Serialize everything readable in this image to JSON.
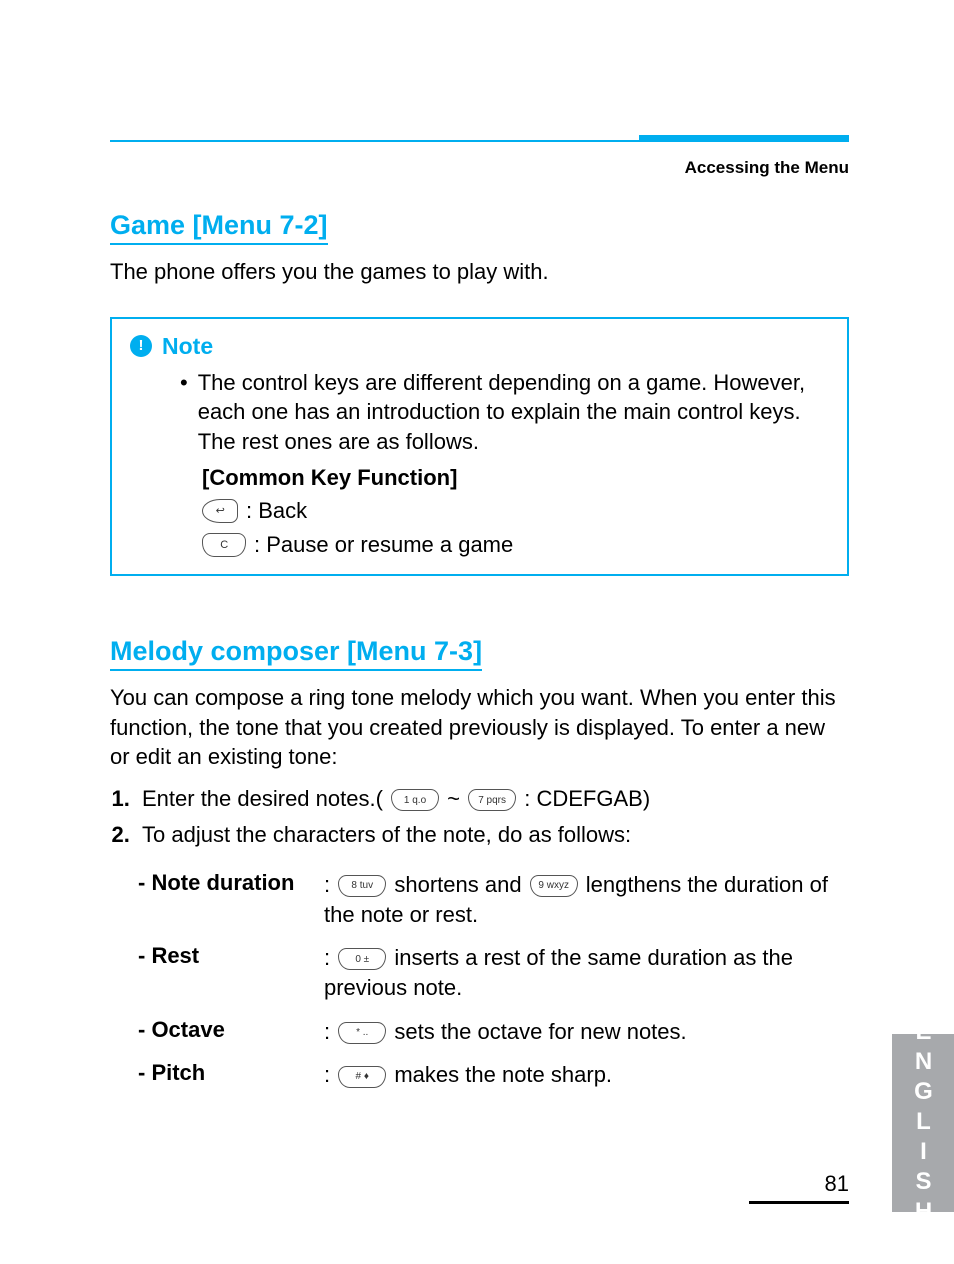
{
  "header": {
    "breadcrumb": "Accessing the Menu"
  },
  "section_game": {
    "title": "Game [Menu 7-2]",
    "intro": "The phone offers you the games to play with."
  },
  "note": {
    "label": "Note",
    "bullet_text": "The control keys are different depending on a game. However, each one has an introduction to explain the main control keys. The rest ones are as follows.",
    "common_key_heading": "[Common Key Function]",
    "keys": {
      "back": {
        "icon_hint": "softkey",
        "desc": ": Back"
      },
      "pause": {
        "icon_hint": "C",
        "desc": ": Pause or resume  a game"
      }
    }
  },
  "section_melody": {
    "title": "Melody composer [Menu 7-3]",
    "intro": "You can compose a ring tone melody which you want. When you enter this function, the tone that you created previously is displayed. To enter a new or edit an existing tone:",
    "steps": {
      "one_prefix": "Enter the desired notes.( ",
      "one_key_from": "1 q.o",
      "one_mid": " ~ ",
      "one_key_to": "7 pqrs",
      "one_suffix": " : CDEFGAB)",
      "two": "To adjust the characters of the note, do as follows:"
    },
    "defs": {
      "note_duration": {
        "label": "- Note duration",
        "colon": ": ",
        "key_short": "8 tuv",
        "mid1": " shortens and ",
        "key_long": "9 wxyz",
        "mid2": " lengthens the duration of the note or rest."
      },
      "rest": {
        "label": "- Rest",
        "colon": ": ",
        "key": "0 ±",
        "text": " inserts a rest of the same duration as the previous note."
      },
      "octave": {
        "label": "- Octave",
        "colon": ": ",
        "key": "* ..",
        "text": " sets the octave for new notes."
      },
      "pitch": {
        "label": "- Pitch",
        "colon": ": ",
        "key": "# ♦",
        "text": " makes the note sharp."
      }
    }
  },
  "side_tab": "ENGLISH",
  "page_number": "81"
}
